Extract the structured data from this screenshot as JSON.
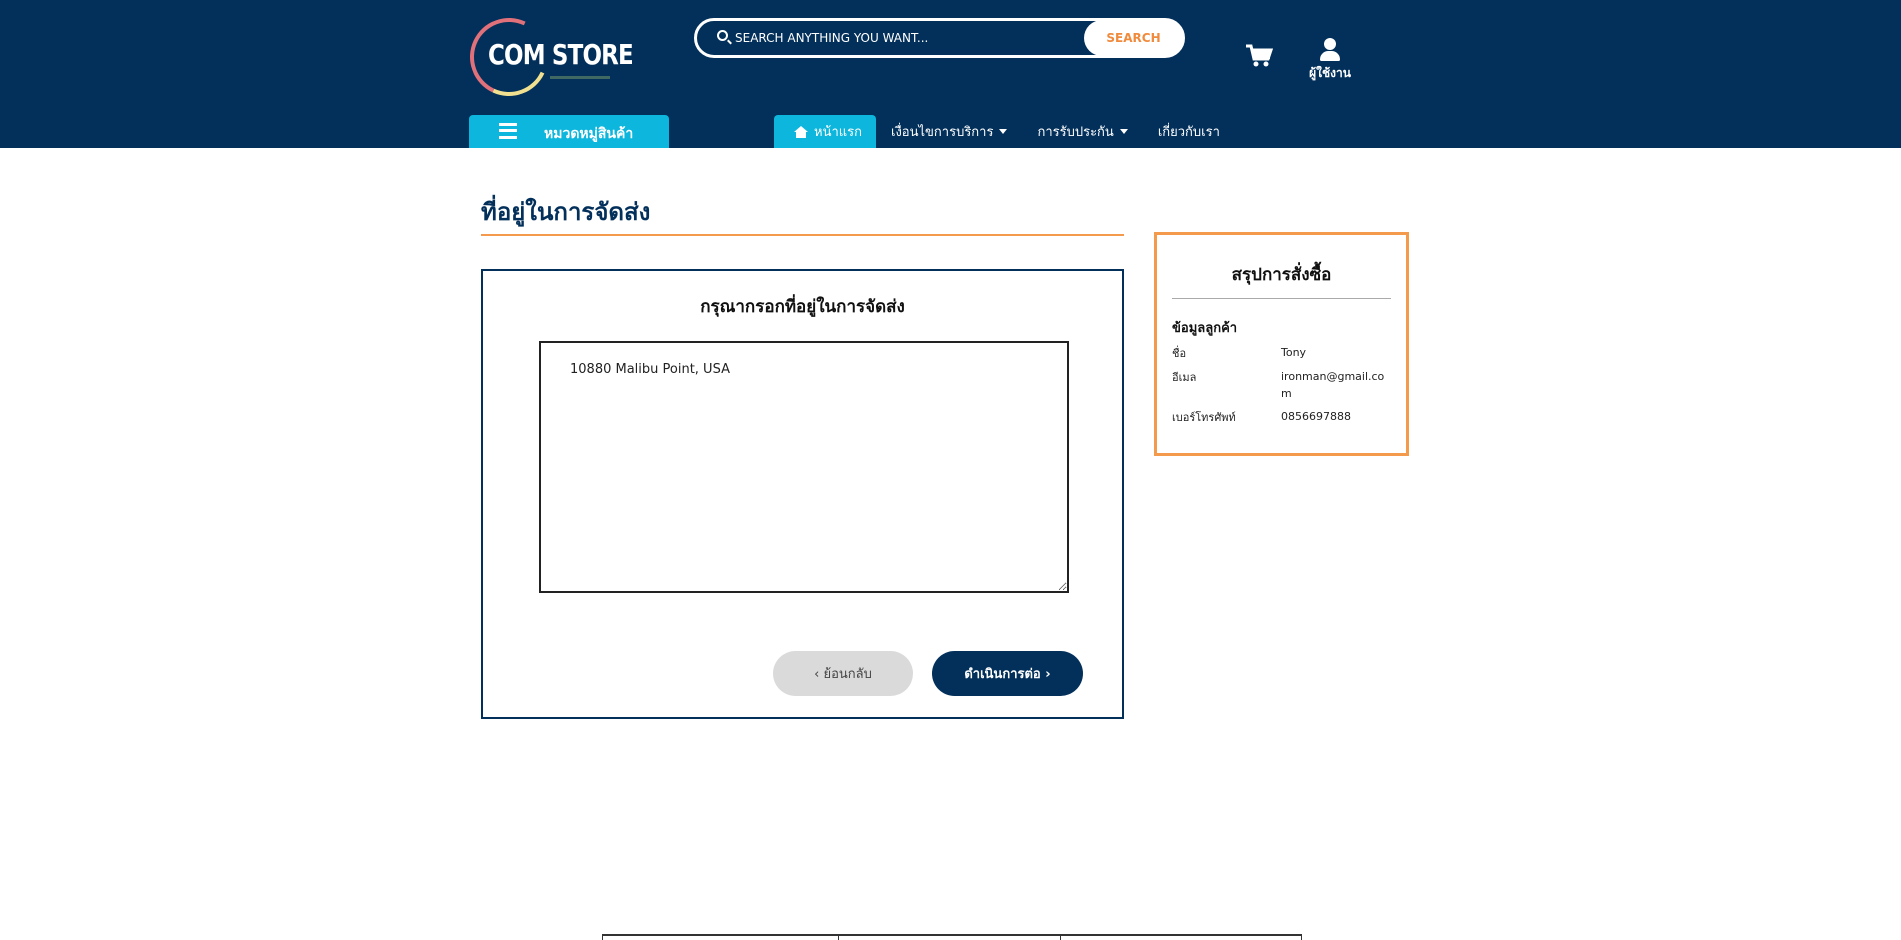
{
  "header": {
    "logo_text": "COM STORE",
    "search_placeholder": "SEARCH ANYTHING YOU WANT...",
    "search_button": "SEARCH",
    "user_label": "ผู้ใช้งาน",
    "category_button": "หมวดหมู่สินค้า",
    "nav": [
      {
        "label": "หน้าแรก",
        "active": true
      },
      {
        "label": "เงื่อนไขการบริการ",
        "dropdown": true
      },
      {
        "label": "การรับประกัน",
        "dropdown": true
      },
      {
        "label": "เกี่ยวกับเรา"
      }
    ]
  },
  "main": {
    "title": "ที่อยู่ในการจัดส่ง",
    "form_heading": "กรุณากรอกที่อยู่ในการจัดส่ง",
    "address_value": "10880 Malibu Point, USA",
    "back_button": "ย้อนกลับ",
    "next_button": "ดำเนินการต่อ"
  },
  "summary": {
    "title": "สรุปการสั่งซื้อ",
    "section": "ข้อมูลลูกค้า",
    "rows": [
      {
        "label": "ชื่อ",
        "value": "Tony"
      },
      {
        "label": "อีเมล",
        "value": "ironman@gmail.com"
      },
      {
        "label": "เบอร์โทรศัพท์",
        "value": "0856697888"
      }
    ]
  },
  "colors": {
    "header_bg": "#03305a",
    "accent_cyan": "#0cb6dc",
    "accent_orange": "#f39a4c"
  }
}
